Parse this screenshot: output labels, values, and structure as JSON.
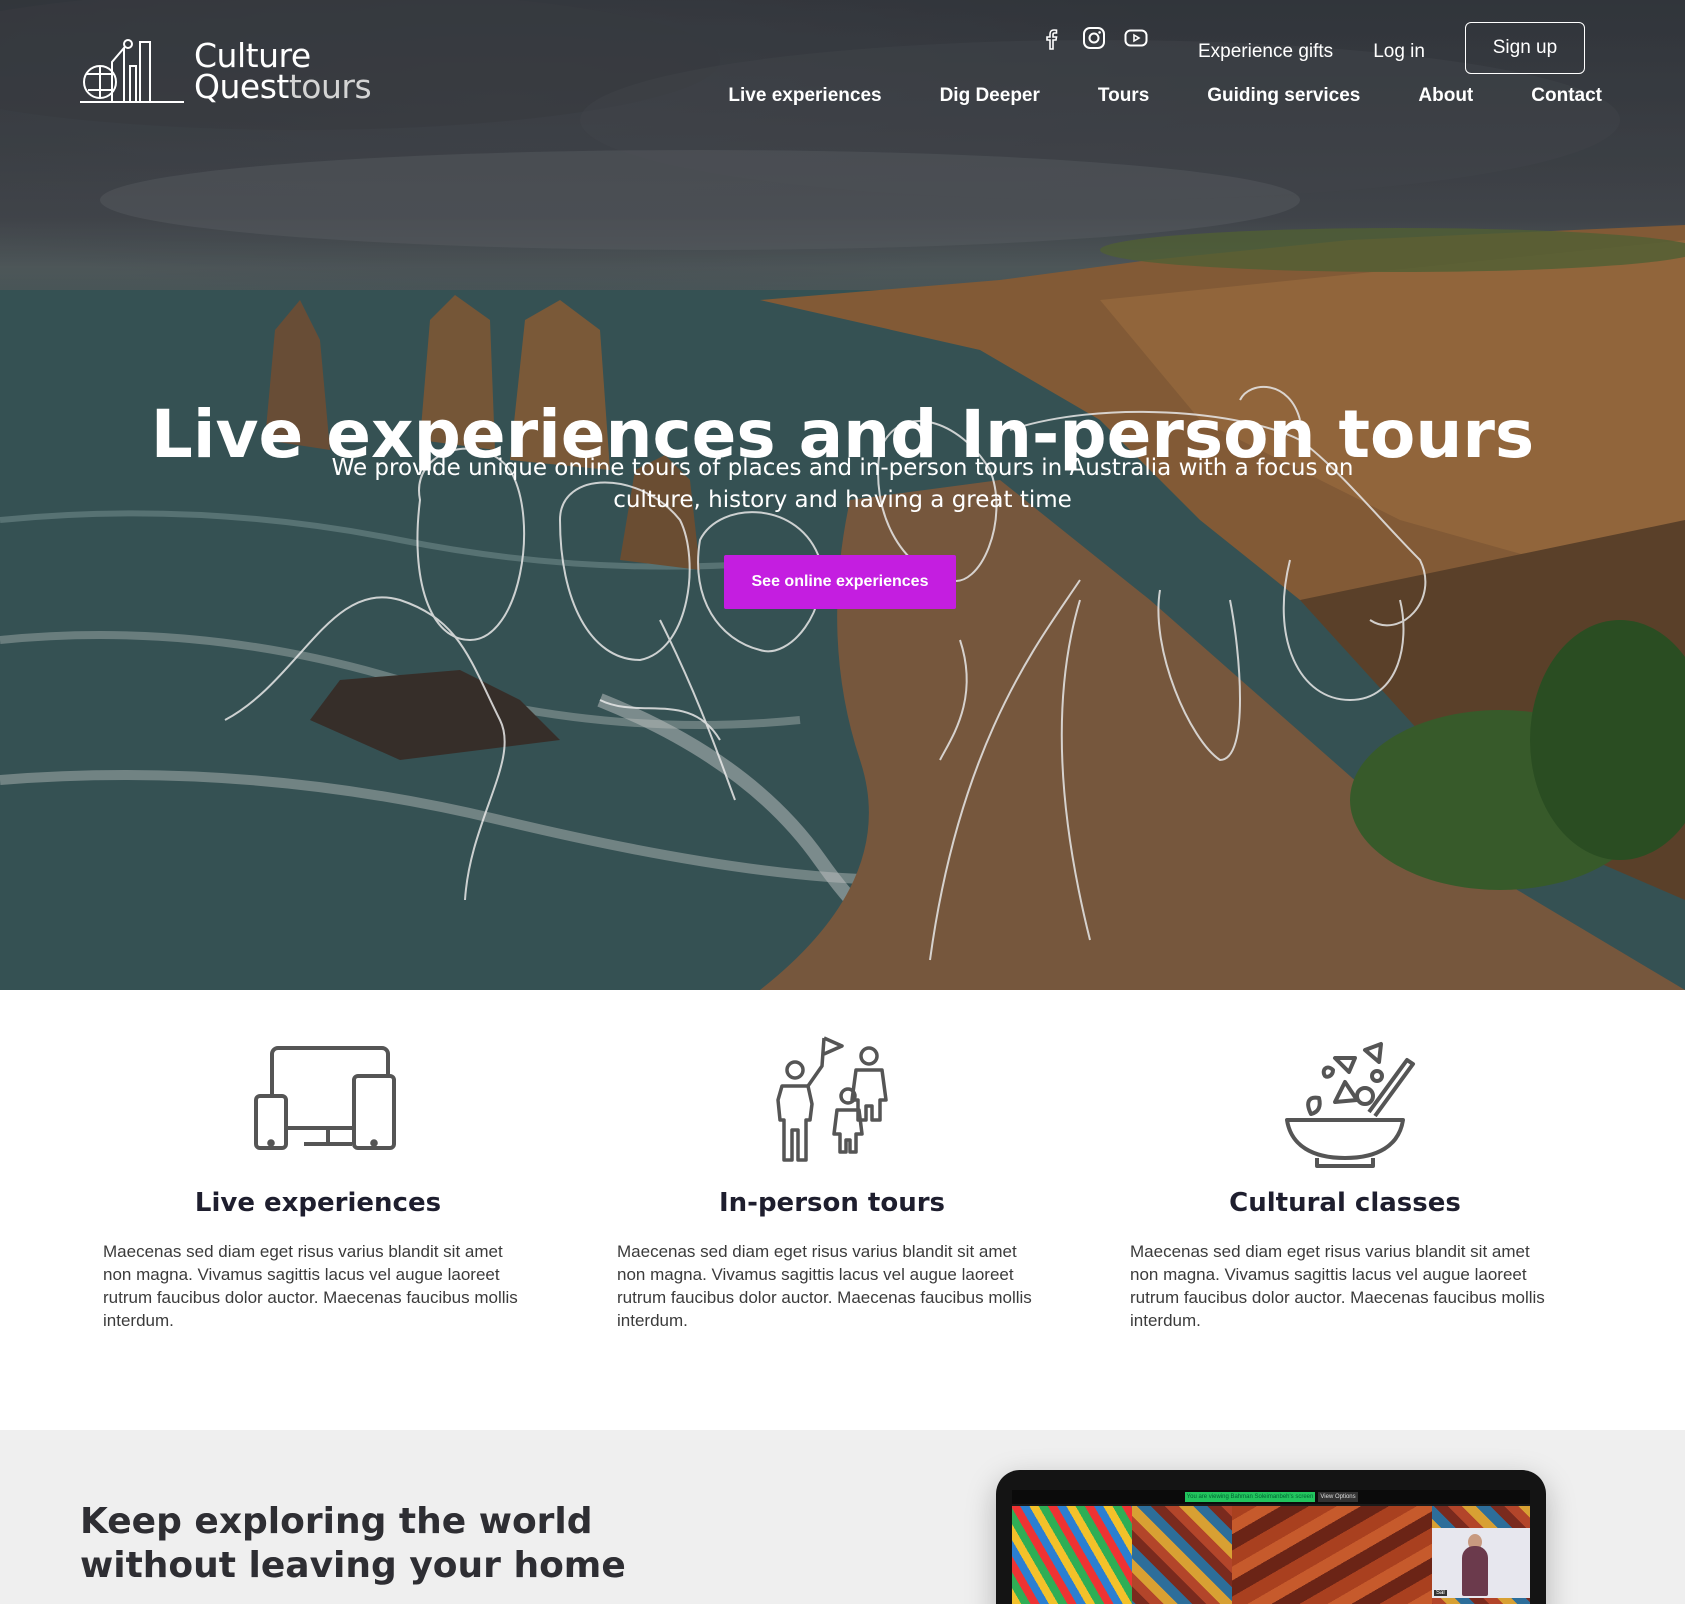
{
  "brand": {
    "line1": "Culture",
    "line2_main": "Quest",
    "line2_sub": "tours"
  },
  "social": [
    {
      "icon": "facebook-icon"
    },
    {
      "icon": "instagram-icon"
    },
    {
      "icon": "youtube-icon"
    }
  ],
  "top_links": {
    "gifts": "Experience gifts",
    "login": "Log in",
    "signup": "Sign up"
  },
  "nav": [
    "Live experiences",
    "Dig Deeper",
    "Tours",
    "Guiding services",
    "About",
    "Contact"
  ],
  "hero": {
    "title": "Live experiences and In-person tours",
    "subtitle": "We provide unique online tours of places and in-person tours in Australia with a focus on culture, history and having a great time",
    "cta": "See online experiences"
  },
  "features": [
    {
      "icon": "devices-icon",
      "title": "Live experiences",
      "text": "Maecenas sed diam eget risus varius blandit sit amet non magna. Vivamus sagittis lacus vel augue laoreet rutrum faucibus dolor auctor. Maecenas faucibus mollis interdum."
    },
    {
      "icon": "tour-group-icon",
      "title": "In-person tours",
      "text": "Maecenas sed diam eget risus varius blandit sit amet non magna. Vivamus sagittis lacus vel augue laoreet rutrum faucibus dolor auctor. Maecenas faucibus mollis interdum."
    },
    {
      "icon": "salad-bowl-icon",
      "title": "Cultural classes",
      "text": "Maecenas sed diam eget risus varius blandit sit amet non magna. Vivamus sagittis lacus vel augue laoreet rutrum faucibus dolor auctor. Maecenas faucibus mollis interdum."
    }
  ],
  "bottom": {
    "heading_line1": "Keep exploring the world",
    "heading_line2": "without leaving your home",
    "zoom_banner": "You are viewing Bahman Soleimanbeh's screen",
    "zoom_options": "View Options",
    "participant": "Sal"
  },
  "colors": {
    "accent": "#c41ee0",
    "heading": "#1e1e2e",
    "section_bg": "#efefef"
  }
}
